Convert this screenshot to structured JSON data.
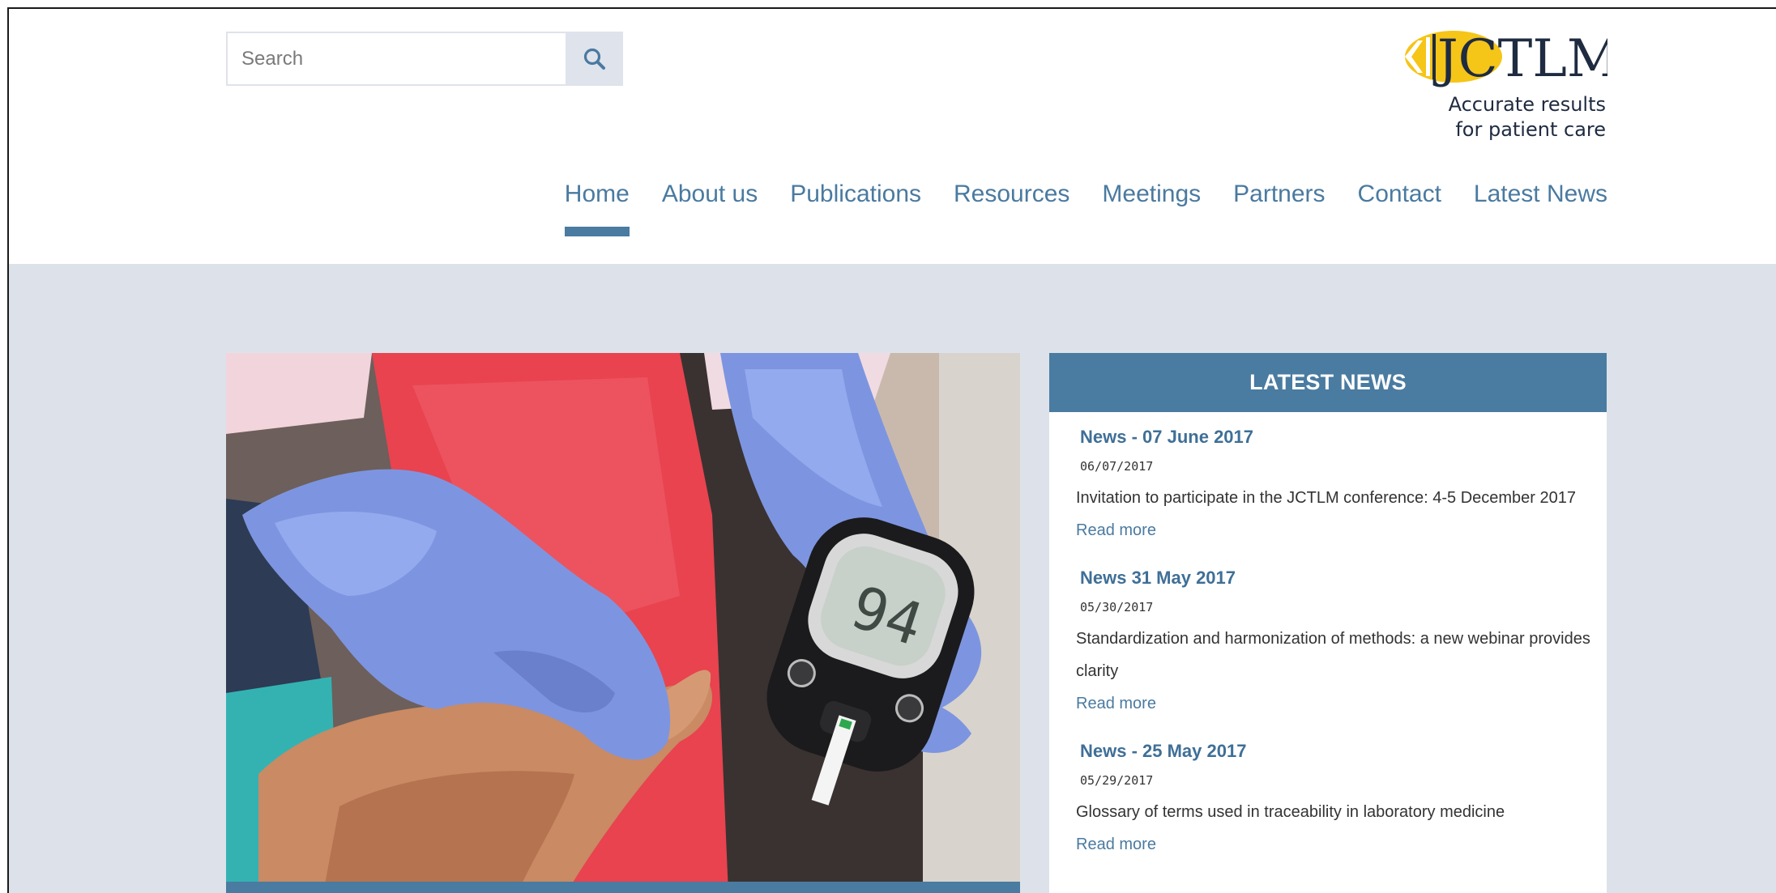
{
  "search": {
    "placeholder": "Search",
    "button_icon": "search-icon"
  },
  "logo": {
    "text": "JCTLM",
    "tagline_line1": "Accurate results",
    "tagline_line2": "for patient care",
    "accent": "#f5c518"
  },
  "nav": {
    "items": [
      {
        "label": "Home",
        "active": true
      },
      {
        "label": "About us"
      },
      {
        "label": "Publications"
      },
      {
        "label": "Resources"
      },
      {
        "label": "Meetings"
      },
      {
        "label": "Partners"
      },
      {
        "label": "Contact"
      },
      {
        "label": "Latest News"
      }
    ]
  },
  "news": {
    "heading": "LATEST NEWS",
    "items": [
      {
        "title": "News - 07 June 2017",
        "date": "06/07/2017",
        "text": "Invitation to participate in the JCTLM conference: 4-5 December 2017",
        "more": "Read more"
      },
      {
        "title": "News 31 May 2017",
        "date": "05/30/2017",
        "text": "Standardization and harmonization of methods: a new webinar provides clarity",
        "more": "Read more"
      },
      {
        "title": "News - 25 May 2017",
        "date": "05/29/2017",
        "text": "Glossary of terms used in traceability in laboratory medicine",
        "more": "Read more"
      }
    ]
  },
  "hero": {
    "meter_reading": "94"
  },
  "colors": {
    "brand_blue": "#4a7ba1",
    "link_blue": "#4a7aa0",
    "band_bg": "#dde2ea",
    "glove": "#7d95e0"
  }
}
